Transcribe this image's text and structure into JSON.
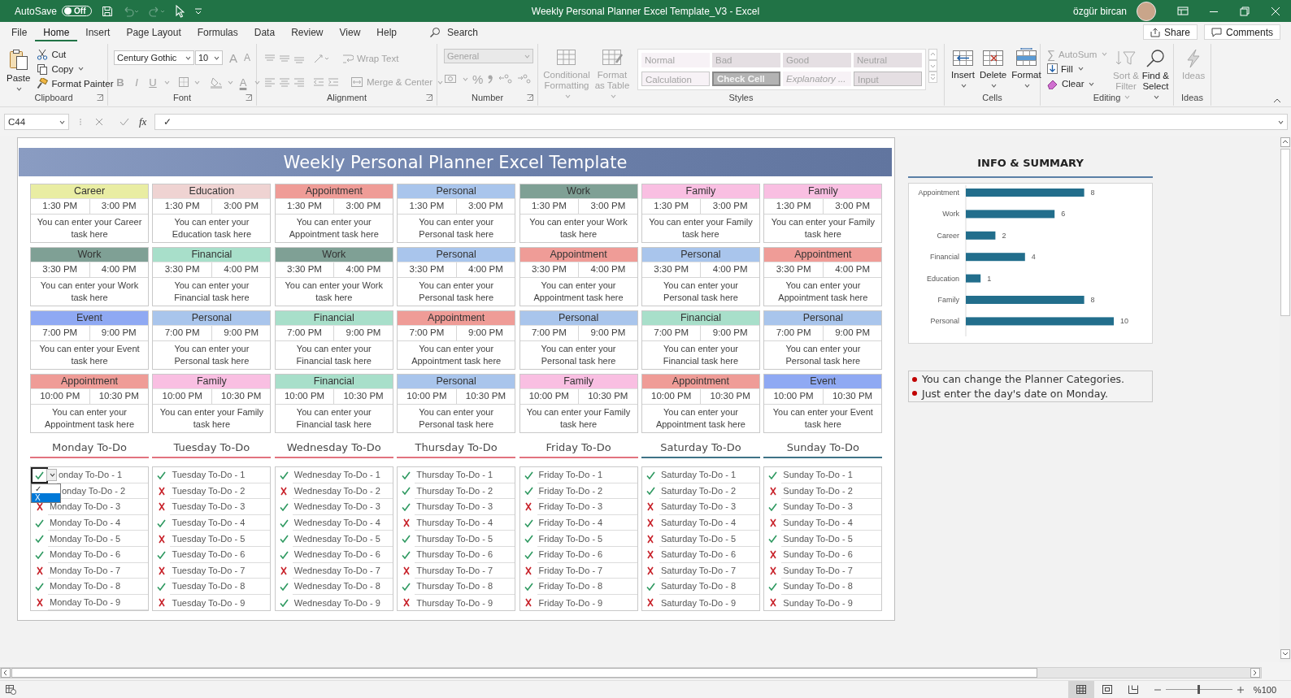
{
  "title_bar": {
    "autosave_label": "AutoSave",
    "autosave": {
      "on": false,
      "label": "Off"
    },
    "title": "Weekly Personal Planner Excel Template_V3 - Excel",
    "user": "özgür bircan"
  },
  "ribbon_tabs": [
    {
      "label": "File",
      "selected": false
    },
    {
      "label": "Home",
      "selected": true
    },
    {
      "label": "Insert",
      "selected": false
    },
    {
      "label": "Page Layout",
      "selected": false
    },
    {
      "label": "Formulas",
      "selected": false
    },
    {
      "label": "Data",
      "selected": false
    },
    {
      "label": "Review",
      "selected": false
    },
    {
      "label": "View",
      "selected": false
    },
    {
      "label": "Help",
      "selected": false
    }
  ],
  "search": {
    "label": "Search"
  },
  "share": "Share",
  "comments": "Comments",
  "ribbon": {
    "clipboard": {
      "label": "Clipboard",
      "paste": {
        "label": "Paste",
        "disabled": false
      },
      "cut": {
        "label": "Cut",
        "disabled": false
      },
      "copy": {
        "label": "Copy",
        "disabled": false
      },
      "format_painter": {
        "label": "Format Painter",
        "disabled": false
      }
    },
    "font": {
      "label": "Font",
      "name": "Century Gothic",
      "size": "10",
      "buttons": [
        {
          "label": "A",
          "kind": "grow",
          "disabled": true
        },
        {
          "label": "A",
          "kind": "shrink",
          "disabled": true
        },
        {
          "label": "B",
          "kind": "bold",
          "disabled": true
        },
        {
          "label": "I",
          "kind": "italic",
          "disabled": true
        },
        {
          "label": "U",
          "kind": "underline",
          "disabled": true
        },
        {
          "label": "A",
          "kind": "font_color",
          "disabled": true
        }
      ]
    },
    "alignment": {
      "label": "Alignment",
      "wrap_text": {
        "label": "Wrap Text",
        "disabled": true
      },
      "merge": {
        "label": "Merge & Center",
        "disabled": true
      }
    },
    "number": {
      "label": "Number",
      "format": {
        "value": "General",
        "disabled": true
      },
      "percent": {
        "label": "%",
        "disabled": true
      }
    },
    "styles": {
      "label": "Styles",
      "conditional": {
        "label": "Conditional Formatting",
        "disabled": true
      },
      "format_table": {
        "label": "Format as Table",
        "disabled": true
      },
      "gallery": [
        {
          "label": "Normal",
          "kind": "normal"
        },
        {
          "label": "Bad",
          "kind": "shaded"
        },
        {
          "label": "Good",
          "kind": "shaded"
        },
        {
          "label": "Neutral",
          "kind": "shaded"
        },
        {
          "label": "Calculation",
          "kind": "outlined"
        },
        {
          "label": "Check Cell",
          "kind": "check"
        },
        {
          "label": "Explanatory ...",
          "kind": "italic"
        },
        {
          "label": "Input",
          "kind": "input"
        }
      ]
    },
    "cells": {
      "label": "Cells",
      "buttons": [
        {
          "label": "Insert",
          "kind": "insert",
          "disabled": false
        },
        {
          "label": "Delete",
          "kind": "delete",
          "disabled": false
        },
        {
          "label": "Format",
          "kind": "format",
          "disabled": false
        }
      ]
    },
    "editing": {
      "label": "Editing",
      "autosum": {
        "symbol": "∑",
        "label": "AutoSum",
        "disabled": true
      },
      "fill": {
        "label": "Fill",
        "disabled": false
      },
      "clear": {
        "label": "Clear",
        "disabled": false
      },
      "sort_filter": {
        "label": "Sort & Filter",
        "disabled": true
      },
      "find_select": {
        "label": "Find & Select",
        "disabled": false
      }
    },
    "ideas": {
      "label": "Ideas",
      "button": {
        "label": "Ideas",
        "disabled": true
      }
    }
  },
  "formula_bar": {
    "name_box": "C44",
    "fx": "fx",
    "value": "✓"
  },
  "sheet": {
    "banner": "Weekly Personal Planner Excel Template",
    "planner": [
      {
        "entries": [
          {
            "category": "Career",
            "color": "#e9eda3",
            "start": "1:30 PM",
            "end": "3:00 PM",
            "text": "You can enter your Career task here"
          },
          {
            "category": "Education",
            "color": "#efd3d2",
            "start": "1:30 PM",
            "end": "3:00 PM",
            "text": "You can enter your Education task here"
          },
          {
            "category": "Appointment",
            "color": "#ef9c97",
            "start": "1:30 PM",
            "end": "3:00 PM",
            "text": "You can enter your Appointment task here"
          },
          {
            "category": "Personal",
            "color": "#a9c5ec",
            "start": "1:30 PM",
            "end": "3:00 PM",
            "text": "You can enter your Personal task here"
          },
          {
            "category": "Work",
            "color": "#7fa095",
            "start": "1:30 PM",
            "end": "3:00 PM",
            "text": "You can enter your Work task here"
          },
          {
            "category": "Family",
            "color": "#f9bfe2",
            "start": "1:30 PM",
            "end": "3:00 PM",
            "text": "You can enter your Family task here"
          },
          {
            "category": "Family",
            "color": "#f9bfe2",
            "start": "1:30 PM",
            "end": "3:00 PM",
            "text": "You can enter your Family task here"
          }
        ]
      },
      {
        "entries": [
          {
            "category": "Work",
            "color": "#7fa095",
            "start": "3:30 PM",
            "end": "4:00 PM",
            "text": "You can enter your Work task here"
          },
          {
            "category": "Financial",
            "color": "#a8dfca",
            "start": "3:30 PM",
            "end": "4:00 PM",
            "text": "You can enter your Financial task here"
          },
          {
            "category": "Work",
            "color": "#7fa095",
            "start": "3:30 PM",
            "end": "4:00 PM",
            "text": "You can enter your Work task here"
          },
          {
            "category": "Personal",
            "color": "#a9c5ec",
            "start": "3:30 PM",
            "end": "4:00 PM",
            "text": "You can enter your Personal task here"
          },
          {
            "category": "Appointment",
            "color": "#ef9c97",
            "start": "3:30 PM",
            "end": "4:00 PM",
            "text": "You can enter your Appointment task here"
          },
          {
            "category": "Personal",
            "color": "#a9c5ec",
            "start": "3:30 PM",
            "end": "4:00 PM",
            "text": "You can enter your Personal task here"
          },
          {
            "category": "Appointment",
            "color": "#ef9c97",
            "start": "3:30 PM",
            "end": "4:00 PM",
            "text": "You can enter your Appointment task here"
          }
        ]
      },
      {
        "entries": [
          {
            "category": "Event",
            "color": "#8fa9f3",
            "start": "7:00 PM",
            "end": "9:00 PM",
            "text": "You can enter your Event task here"
          },
          {
            "category": "Personal",
            "color": "#a9c5ec",
            "start": "7:00 PM",
            "end": "9:00 PM",
            "text": "You can enter your Personal task here"
          },
          {
            "category": "Financial",
            "color": "#a8dfca",
            "start": "7:00 PM",
            "end": "9:00 PM",
            "text": "You can enter your Financial task here"
          },
          {
            "category": "Appointment",
            "color": "#ef9c97",
            "start": "7:00 PM",
            "end": "9:00 PM",
            "text": "You can enter your Appointment task here"
          },
          {
            "category": "Personal",
            "color": "#a9c5ec",
            "start": "7:00 PM",
            "end": "9:00 PM",
            "text": "You can enter your Personal task here"
          },
          {
            "category": "Financial",
            "color": "#a8dfca",
            "start": "7:00 PM",
            "end": "9:00 PM",
            "text": "You can enter your Financial task here"
          },
          {
            "category": "Personal",
            "color": "#a9c5ec",
            "start": "7:00 PM",
            "end": "9:00 PM",
            "text": "You can enter your Personal task here"
          }
        ]
      },
      {
        "entries": [
          {
            "category": "Appointment",
            "color": "#ef9c97",
            "start": "10:00 PM",
            "end": "10:30 PM",
            "text": "You can enter your Appointment task here"
          },
          {
            "category": "Family",
            "color": "#f9bfe2",
            "start": "10:00 PM",
            "end": "10:30 PM",
            "text": "You can enter your Family task here"
          },
          {
            "category": "Financial",
            "color": "#a8dfca",
            "start": "10:00 PM",
            "end": "10:30 PM",
            "text": "You can enter your Financial task here"
          },
          {
            "category": "Personal",
            "color": "#a9c5ec",
            "start": "10:00 PM",
            "end": "10:30 PM",
            "text": "You can enter your Personal task here"
          },
          {
            "category": "Family",
            "color": "#f9bfe2",
            "start": "10:00 PM",
            "end": "10:30 PM",
            "text": "You can enter your Family task here"
          },
          {
            "category": "Appointment",
            "color": "#ef9c97",
            "start": "10:00 PM",
            "end": "10:30 PM",
            "text": "You can enter your Appointment task here"
          },
          {
            "category": "Event",
            "color": "#8fa9f3",
            "start": "10:00 PM",
            "end": "10:30 PM",
            "text": "You can enter your Event task here"
          }
        ]
      }
    ],
    "todo": [
      {
        "title": "Monday To-Do",
        "color": "#e2737f",
        "dropdown": {
          "options": [
            {
              "label": "✓",
              "selected": false
            },
            {
              "label": "X",
              "selected": true
            }
          ]
        },
        "items": [
          {
            "text": "onday To-Do - 1",
            "done": true,
            "active": true
          },
          {
            "text": "onday To-Do - 2"
          },
          {
            "text": "Monday To-Do - 3",
            "done": false,
            "active": false
          },
          {
            "text": "Monday To-Do - 4",
            "done": true,
            "active": false
          },
          {
            "text": "Monday To-Do - 5",
            "done": true,
            "active": false
          },
          {
            "text": "Monday To-Do - 6",
            "done": true,
            "active": false
          },
          {
            "text": "Monday To-Do - 7",
            "done": false,
            "active": false
          },
          {
            "text": "Monday To-Do - 8",
            "done": true,
            "active": false
          },
          {
            "text": "Monday To-Do - 9",
            "done": false,
            "active": false
          }
        ]
      },
      {
        "title": "Tuesday To-Do",
        "color": "#e2737f",
        "items": [
          {
            "text": "Tuesday To-Do - 1",
            "done": true
          },
          {
            "text": "Tuesday To-Do - 2",
            "done": false
          },
          {
            "text": "Tuesday To-Do - 3",
            "done": false
          },
          {
            "text": "Tuesday To-Do - 4",
            "done": true
          },
          {
            "text": "Tuesday To-Do - 5",
            "done": false
          },
          {
            "text": "Tuesday To-Do - 6",
            "done": true
          },
          {
            "text": "Tuesday To-Do - 7",
            "done": false
          },
          {
            "text": "Tuesday To-Do - 8",
            "done": true
          },
          {
            "text": "Tuesday To-Do - 9",
            "done": false
          }
        ]
      },
      {
        "title": "Wednesday To-Do",
        "color": "#e2737f",
        "items": [
          {
            "text": "Wednesday To-Do - 1",
            "done": true
          },
          {
            "text": "Wednesday To-Do - 2",
            "done": false
          },
          {
            "text": "Wednesday To-Do - 3",
            "done": true
          },
          {
            "text": "Wednesday To-Do - 4",
            "done": true
          },
          {
            "text": "Wednesday To-Do - 5",
            "done": true
          },
          {
            "text": "Wednesday To-Do - 6",
            "done": true
          },
          {
            "text": "Wednesday To-Do - 7",
            "done": false
          },
          {
            "text": "Wednesday To-Do - 8",
            "done": true
          },
          {
            "text": "Wednesday To-Do - 9",
            "done": true
          }
        ]
      },
      {
        "title": "Thursday To-Do",
        "color": "#e2737f",
        "items": [
          {
            "text": "Thursday To-Do - 1",
            "done": true
          },
          {
            "text": "Thursday To-Do - 2",
            "done": true
          },
          {
            "text": "Thursday To-Do - 3",
            "done": true
          },
          {
            "text": "Thursday To-Do - 4",
            "done": false
          },
          {
            "text": "Thursday To-Do - 5",
            "done": true
          },
          {
            "text": "Thursday To-Do - 6",
            "done": true
          },
          {
            "text": "Thursday To-Do - 7",
            "done": false
          },
          {
            "text": "Thursday To-Do - 8",
            "done": true
          },
          {
            "text": "Thursday To-Do - 9",
            "done": false
          }
        ]
      },
      {
        "title": "Friday To-Do",
        "color": "#e2737f",
        "items": [
          {
            "text": "Friday To-Do - 1",
            "done": true
          },
          {
            "text": "Friday To-Do - 2",
            "done": true
          },
          {
            "text": "Friday To-Do - 3",
            "done": false
          },
          {
            "text": "Friday To-Do - 4",
            "done": true
          },
          {
            "text": "Friday To-Do - 5",
            "done": true
          },
          {
            "text": "Friday To-Do - 6",
            "done": true
          },
          {
            "text": "Friday To-Do - 7",
            "done": false
          },
          {
            "text": "Friday To-Do - 8",
            "done": true
          },
          {
            "text": "Friday To-Do - 9",
            "done": false
          }
        ]
      },
      {
        "title": "Saturday To-Do",
        "color": "#3f7387",
        "items": [
          {
            "text": "Saturday To-Do - 1",
            "done": true
          },
          {
            "text": "Saturday To-Do - 2",
            "done": true
          },
          {
            "text": "Saturday To-Do - 3",
            "done": false
          },
          {
            "text": "Saturday To-Do - 4",
            "done": false
          },
          {
            "text": "Saturday To-Do - 5",
            "done": false
          },
          {
            "text": "Saturday To-Do - 6",
            "done": false
          },
          {
            "text": "Saturday To-Do - 7",
            "done": false
          },
          {
            "text": "Saturday To-Do - 8",
            "done": true
          },
          {
            "text": "Saturday To-Do - 9",
            "done": false
          }
        ]
      },
      {
        "title": "Sunday To-Do",
        "color": "#3f7387",
        "items": [
          {
            "text": "Sunday To-Do - 1",
            "done": true
          },
          {
            "text": "Sunday To-Do - 2",
            "done": false
          },
          {
            "text": "Sunday To-Do - 3",
            "done": true
          },
          {
            "text": "Sunday To-Do - 4",
            "done": false
          },
          {
            "text": "Sunday To-Do - 5",
            "done": true
          },
          {
            "text": "Sunday To-Do - 6",
            "done": false
          },
          {
            "text": "Sunday To-Do - 7",
            "done": false
          },
          {
            "text": "Sunday To-Do - 8",
            "done": true
          },
          {
            "text": "Sunday To-Do - 9",
            "done": false
          }
        ]
      }
    ],
    "summary": {
      "title": "INFO & SUMMARY",
      "chart_data": {
        "type": "bar",
        "orientation": "horizontal",
        "categories": [
          "Appointment",
          "Work",
          "Career",
          "Financial",
          "Education",
          "Family",
          "Personal"
        ],
        "values": [
          8,
          6,
          2,
          4,
          1,
          8,
          10
        ],
        "data_labels": true
      },
      "notes": [
        "You can change the Planner Categories.",
        "Just enter the day's date on Monday."
      ]
    }
  },
  "status_bar": {
    "views": [
      {
        "kind": "normal",
        "selected": true
      },
      {
        "kind": "page_layout",
        "selected": false
      },
      {
        "kind": "page_break",
        "selected": false
      }
    ],
    "zoom": {
      "level": 0.5,
      "label": "%100"
    }
  }
}
